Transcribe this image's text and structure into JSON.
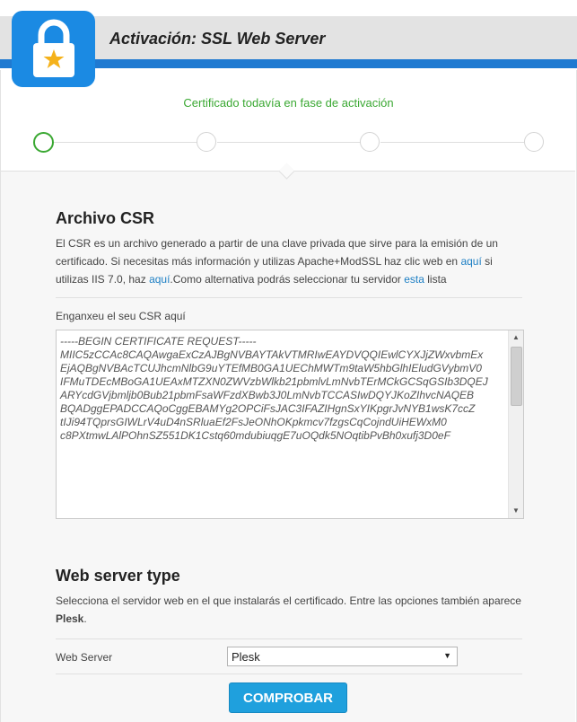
{
  "header": {
    "title": "Activación: SSL Web Server",
    "logo_icon": "lock-star-icon",
    "accent": "#1f7ad1"
  },
  "status": {
    "text": "Certificado todavía en fase de activación",
    "color": "#3aa832"
  },
  "steps": {
    "count": 4,
    "current": 1
  },
  "csr_section": {
    "title": "Archivo CSR",
    "desc_part1": "El CSR es un archivo generado a partir de una clave privada que sirve para la emisión de un certificado. Si necesitas más información y utilizas Apache+ModSSL haz clic web en ",
    "link1": "aquí",
    "desc_part2": " si utilizas IIS 7.0, haz ",
    "link2": "aquí",
    "desc_part3": ".Como alternativa podrás seleccionar tu servidor ",
    "link3": "esta",
    "desc_part4": " lista",
    "field_label": "Enganxeu el seu CSR aquí",
    "field_value": "-----BEGIN CERTIFICATE REQUEST-----\nMIIC5zCCAc8CAQAwgaExCzAJBgNVBAYTAkVTMRIwEAYDVQQIEwlCYXJjZWxvbmEx\nEjAQBgNVBAcTCUJhcmNlbG9uYTEfMB0GA1UEChMWTm9taW5hbGlhIEludGVybmV0\nIFMuTDEcMBoGA1UEAxMTZXN0ZWVzbWlkb21pbmlvLmNvbTErMCkGCSqGSIb3DQEJ\nARYcdGVjbmljb0Bub21pbmFsaWFzdXBwb3J0LmNvbTCCASIwDQYJKoZIhvcNAQEB\nBQADggEPADCCAQoCggEBAMYg2OPCiFsJAC3IFAZIHgnSxYIKpgrJvNYB1wsK7ccZ\ntIJi94TQprsGIWLrV4uD4nSRluaEf2FsJeONhOKpkmcv7fzgsCqCojndUiHEWxM0\nc8PXtmwLAlPOhnSZ551DK1Cstq60mdubiuqgE7uOQdk5NOqtibPvBh0xufj3D0eF"
  },
  "server_section": {
    "title": "Web server type",
    "desc_part1": "Selecciona el servidor web en el que instalarás el certificado. Entre las opciones también aparece ",
    "desc_bold": "Plesk",
    "desc_part2": ".",
    "field_label": "Web Server",
    "selected": "Plesk",
    "button": "COMPROBAR"
  }
}
